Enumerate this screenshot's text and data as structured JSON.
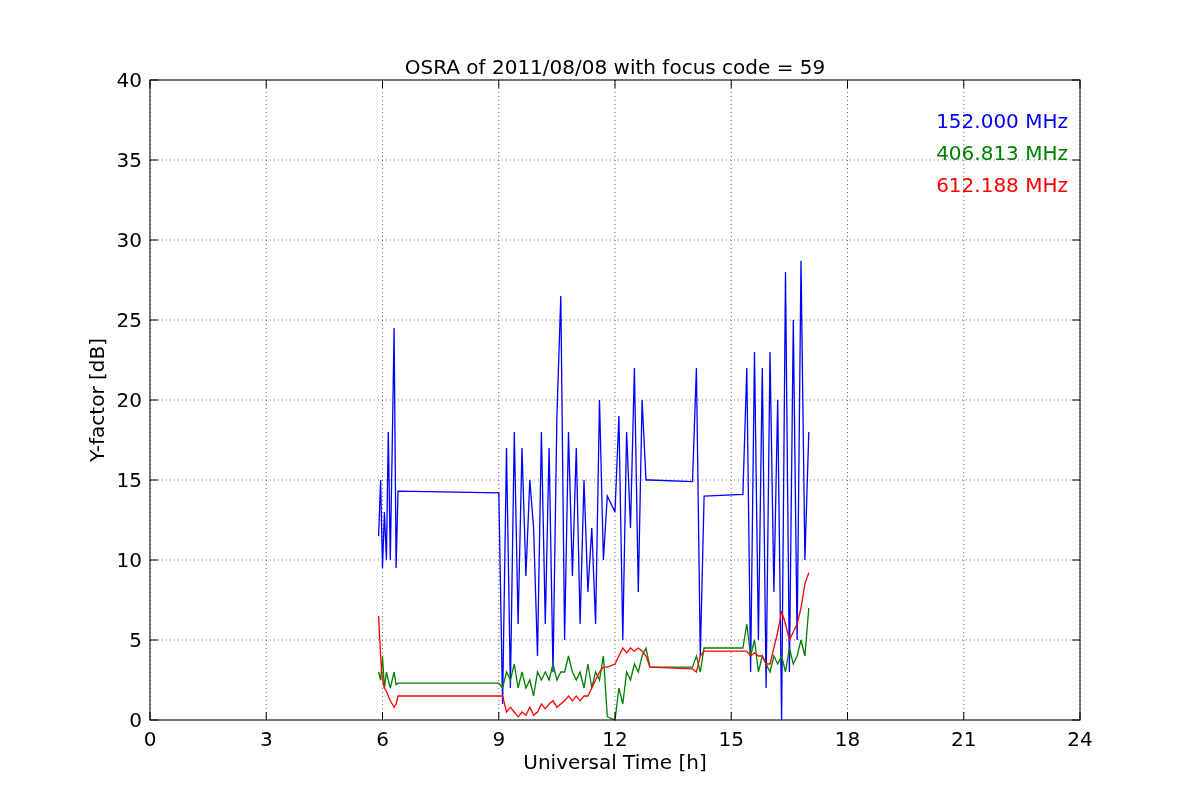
{
  "chart_data": {
    "type": "line",
    "title": "OSRA of 2011/08/08 with focus code = 59",
    "xlabel": "Universal Time [h]",
    "ylabel": "Y-factor [dB]",
    "grid": true,
    "xlim": [
      0,
      24
    ],
    "ylim": [
      0,
      40
    ],
    "xticks": [
      0,
      3,
      6,
      9,
      12,
      15,
      18,
      21,
      24
    ],
    "yticks": [
      0,
      5,
      10,
      15,
      20,
      25,
      30,
      35,
      40
    ],
    "x": [
      5.9,
      5.95,
      6.0,
      6.05,
      6.1,
      6.15,
      6.2,
      6.25,
      6.3,
      6.35,
      6.4,
      9.0,
      9.1,
      9.2,
      9.3,
      9.4,
      9.5,
      9.6,
      9.7,
      9.8,
      9.9,
      10.0,
      10.1,
      10.2,
      10.3,
      10.4,
      10.5,
      10.6,
      10.7,
      10.8,
      10.9,
      11.0,
      11.1,
      11.2,
      11.3,
      11.4,
      11.5,
      11.6,
      11.7,
      11.8,
      12.0,
      12.1,
      12.2,
      12.3,
      12.4,
      12.5,
      12.6,
      12.7,
      12.8,
      12.9,
      14.0,
      14.1,
      14.2,
      14.3,
      15.3,
      15.4,
      15.5,
      15.6,
      15.7,
      15.8,
      15.9,
      16.0,
      16.1,
      16.2,
      16.3,
      16.4,
      16.5,
      16.6,
      16.7,
      16.8,
      16.9,
      17.0
    ],
    "series": [
      {
        "name": "152.000 MHz",
        "color": "#0000ff",
        "values": [
          11.5,
          15,
          9.5,
          13,
          10,
          18,
          10,
          17,
          24.5,
          9.5,
          14.3,
          14.2,
          1,
          17,
          2,
          18,
          6,
          17,
          9,
          15,
          12,
          4,
          18,
          6,
          17,
          3,
          19,
          26.5,
          5,
          18,
          9,
          17,
          6,
          15,
          8,
          12,
          6,
          20,
          10,
          14,
          13,
          19,
          5,
          18,
          12,
          22,
          8,
          20,
          15,
          15,
          14.9,
          22,
          4,
          14,
          14.1,
          22,
          3,
          23,
          5,
          22,
          2,
          23,
          8,
          20,
          0,
          28,
          3,
          25,
          5,
          28.7,
          10,
          18
        ]
      },
      {
        "name": "406.813 MHz",
        "color": "#008000",
        "values": [
          3,
          2.5,
          4,
          2,
          3,
          2.5,
          2,
          2.5,
          3,
          2.2,
          2.3,
          2.3,
          2.0,
          3.0,
          2.5,
          3.5,
          2.0,
          3.0,
          2.0,
          2.5,
          1.5,
          3.0,
          2.5,
          3.0,
          2.5,
          3.5,
          2.5,
          3.0,
          3.0,
          4.0,
          3.0,
          2.5,
          3.0,
          2.0,
          3.5,
          2.0,
          3.0,
          2.5,
          4.0,
          0.2,
          0,
          2,
          1,
          3,
          2.5,
          3.5,
          3,
          4,
          4.5,
          3.3,
          3.3,
          4,
          3,
          4.5,
          4.5,
          6,
          4,
          5,
          3,
          4,
          3.5,
          3,
          4,
          3.5,
          4,
          3,
          4.5,
          3.5,
          4,
          5,
          4,
          7
        ]
      },
      {
        "name": "612.188 MHz",
        "color": "#ff0000",
        "values": [
          6.5,
          4,
          2.5,
          2,
          1.8,
          1.5,
          1.2,
          1,
          0.8,
          1,
          1.5,
          1.5,
          1.5,
          0.5,
          0.8,
          0.5,
          0.2,
          0.5,
          0.3,
          0.8,
          0.3,
          0.5,
          1.0,
          0.7,
          1.0,
          1.2,
          0.8,
          1.0,
          1.2,
          1.5,
          1.2,
          1.5,
          1.2,
          1.5,
          1.5,
          2.0,
          2.5,
          3.0,
          3.3,
          3.3,
          3.5,
          4,
          4.5,
          4.2,
          4.5,
          4.3,
          4.5,
          4.3,
          4.0,
          3.3,
          3.2,
          3,
          4,
          4.3,
          4.3,
          4.3,
          4.0,
          4.2,
          4.0,
          4.0,
          3.5,
          3.5,
          4.5,
          5.5,
          6.8,
          6.0,
          5.0,
          5.5,
          6.0,
          7.0,
          8.5,
          9.2
        ]
      }
    ]
  }
}
